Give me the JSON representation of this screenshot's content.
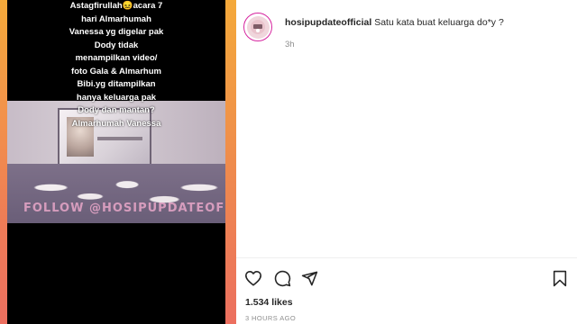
{
  "video": {
    "overlay_lines": [
      "Astagfirullah😖acara 7",
      "hari Almarhumah",
      "Vanessa yg digelar pak",
      "Dody tidak",
      "menampilkan video/",
      "foto Gala & Almarhum",
      "Bibi.yg ditampilkan",
      "hanya keluarga pak",
      "Dody dan mantan?",
      "Almarhumah Vanessa"
    ],
    "watermark": "FOLLOW @HOSIPUPDATEOFFICIAL"
  },
  "comment": {
    "username": "hosipupdateofficial",
    "text": "Satu kata buat keluarga do*y ?",
    "time_ago": "3h"
  },
  "actions": {
    "like_icon": "heart-icon",
    "comment_icon": "comment-icon",
    "share_icon": "share-icon",
    "save_icon": "bookmark-icon"
  },
  "likes": "1.534 likes",
  "post_time": "3 HOURS AGO",
  "colors": {
    "text": "#262626",
    "muted": "#8e8e8e",
    "gradient_top": "#f4a93a",
    "gradient_bottom": "#ec6f5f"
  }
}
